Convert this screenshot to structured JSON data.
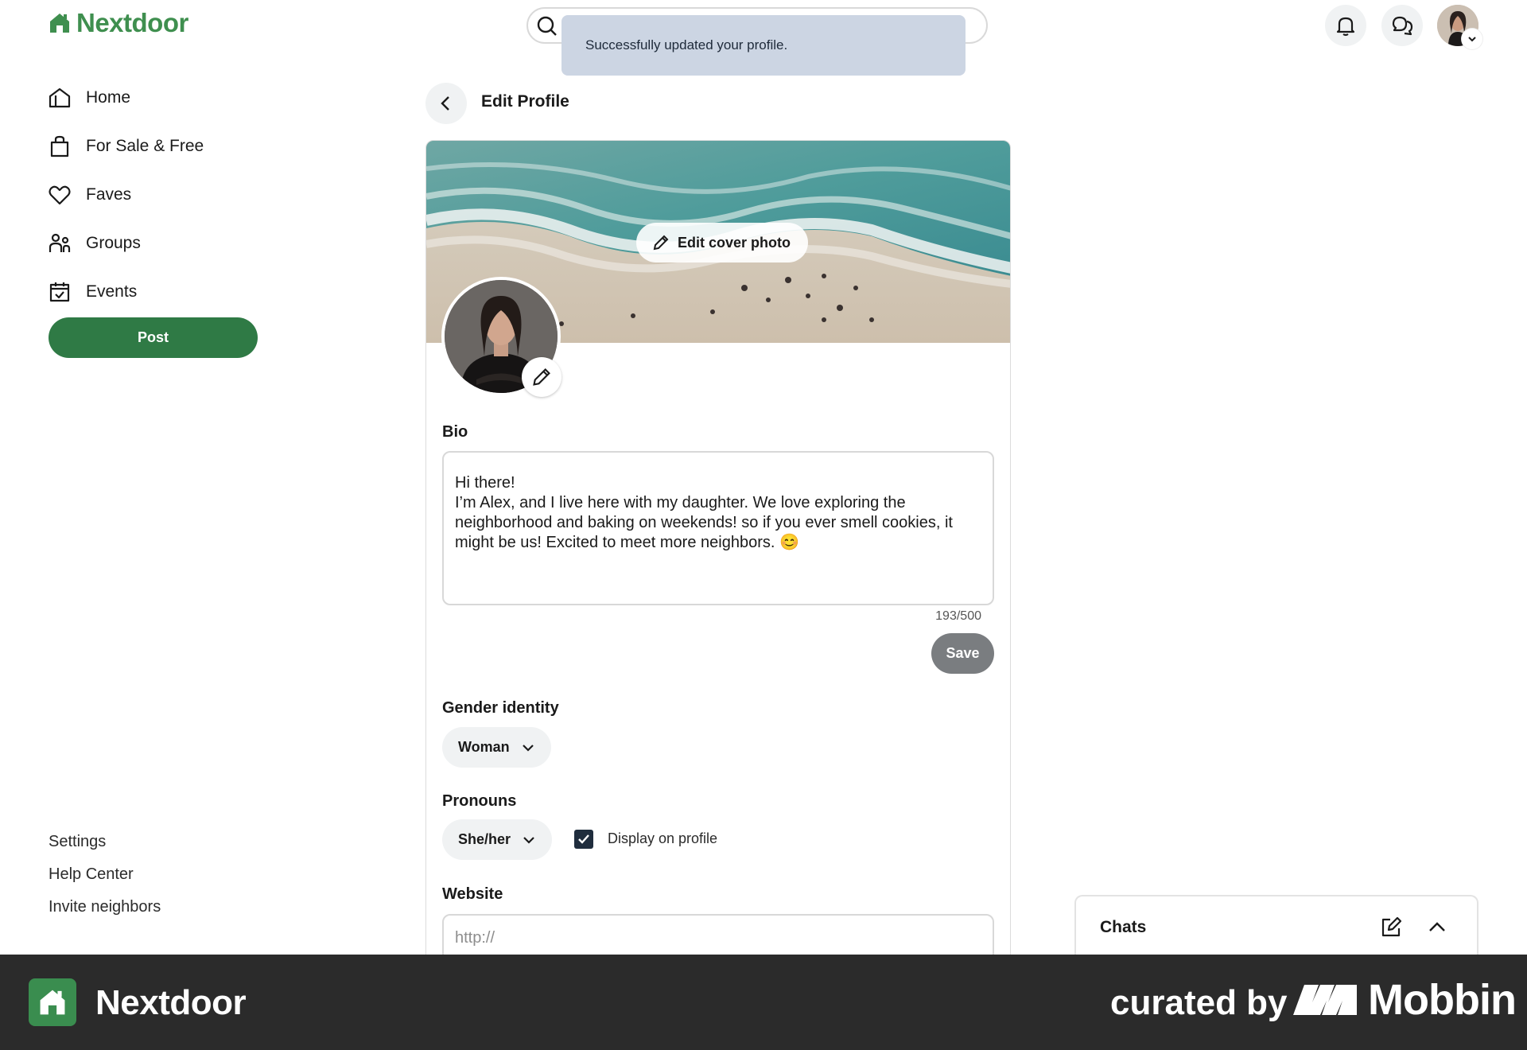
{
  "app": {
    "name": "Nextdoor"
  },
  "sidebar": {
    "items": [
      {
        "label": "Home",
        "icon": "home-icon"
      },
      {
        "label": "For Sale & Free",
        "icon": "shopping-bag-icon"
      },
      {
        "label": "Faves",
        "icon": "heart-icon"
      },
      {
        "label": "Groups",
        "icon": "groups-icon"
      },
      {
        "label": "Events",
        "icon": "calendar-icon"
      }
    ],
    "post_label": "Post",
    "footer": [
      "Settings",
      "Help Center",
      "Invite neighbors"
    ]
  },
  "toast": {
    "message": "Successfully updated your profile."
  },
  "header": {
    "title": "Edit Profile"
  },
  "cover": {
    "edit_label": "Edit cover photo"
  },
  "bio": {
    "label": "Bio",
    "value": "Hi there!\nI’m Alex, and I live here with my daughter. We love exploring the neighborhood and baking on weekends! so if you ever smell cookies, it might be us! Excited to meet more neighbors. 😊",
    "count": "193/500",
    "save_label": "Save"
  },
  "gender": {
    "label": "Gender identity",
    "value": "Woman"
  },
  "pronouns": {
    "label": "Pronouns",
    "value": "She/her",
    "display_label": "Display on profile",
    "display_checked": true
  },
  "website": {
    "label": "Website",
    "placeholder": "http://"
  },
  "chats": {
    "title": "Chats"
  },
  "banner": {
    "app_name": "Nextdoor",
    "curated_by": "curated by",
    "brand": "Mobbin"
  },
  "colors": {
    "brand_green": "#3f8f4f",
    "post_button": "#2f7a45",
    "toast_bg": "#ccd5e3",
    "save_disabled": "#7a7d80"
  }
}
